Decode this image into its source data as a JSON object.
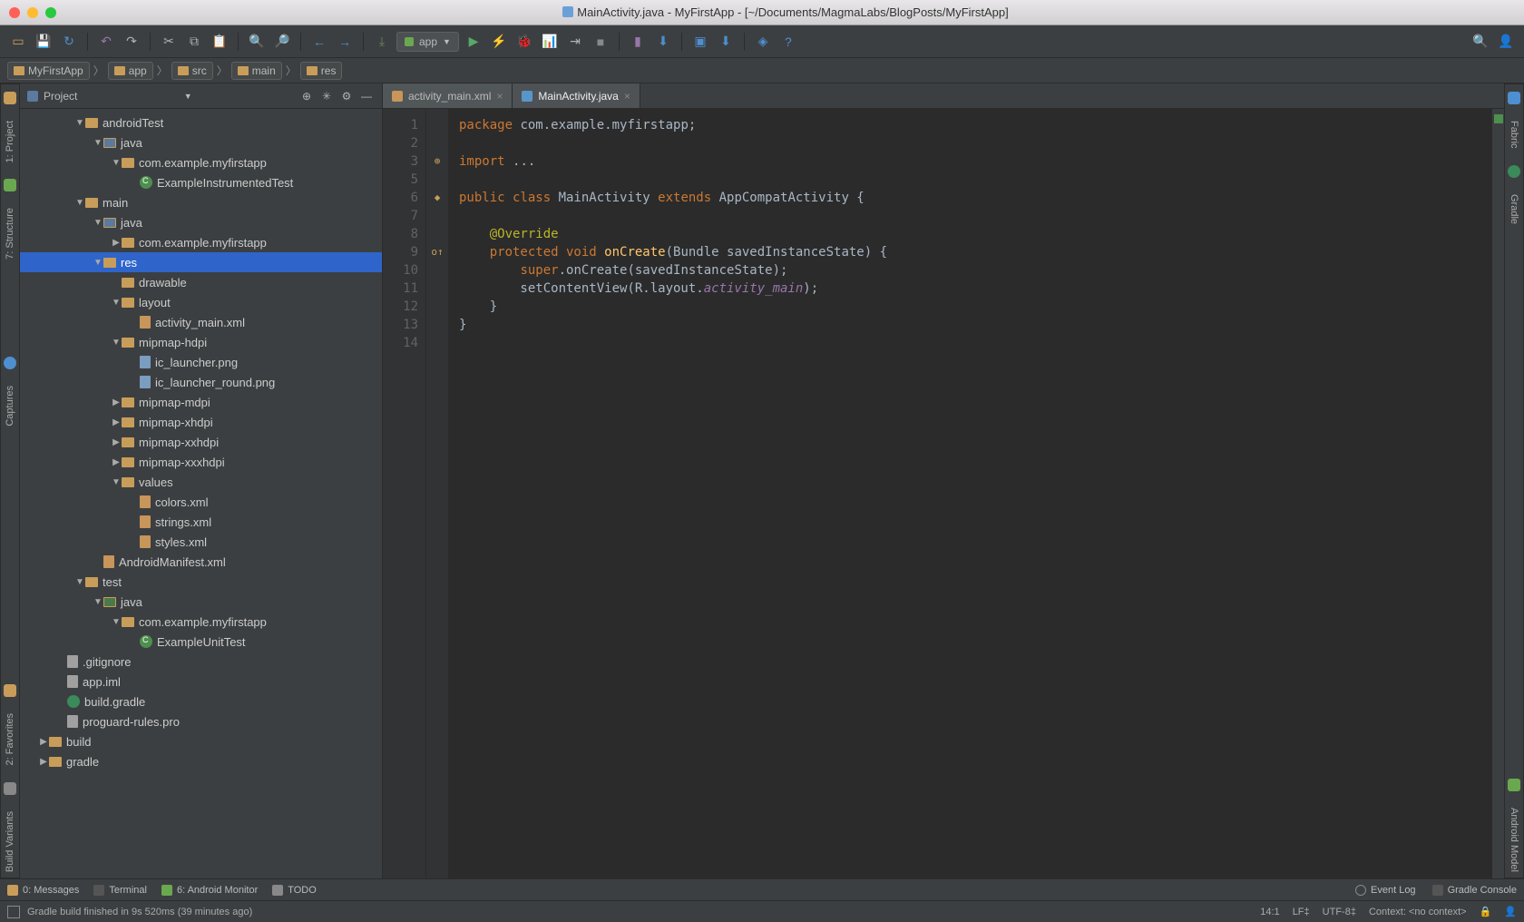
{
  "window": {
    "title": "MainActivity.java - MyFirstApp - [~/Documents/MagmaLabs/BlogPosts/MyFirstApp]"
  },
  "runConfig": "app",
  "breadcrumbs": [
    "MyFirstApp",
    "app",
    "src",
    "main",
    "res"
  ],
  "sidebar": {
    "title": "Project",
    "tree": [
      {
        "indent": 2,
        "arrow": "▼",
        "icon": "folder",
        "label": "androidTest"
      },
      {
        "indent": 3,
        "arrow": "▼",
        "icon": "folder-blue",
        "label": "java"
      },
      {
        "indent": 4,
        "arrow": "▼",
        "icon": "folder",
        "label": "com.example.myfirstapp"
      },
      {
        "indent": 5,
        "arrow": "",
        "icon": "class",
        "label": "ExampleInstrumentedTest"
      },
      {
        "indent": 2,
        "arrow": "▼",
        "icon": "folder",
        "label": "main"
      },
      {
        "indent": 3,
        "arrow": "▼",
        "icon": "folder-blue",
        "label": "java"
      },
      {
        "indent": 4,
        "arrow": "▶",
        "icon": "folder",
        "label": "com.example.myfirstapp"
      },
      {
        "indent": 3,
        "arrow": "▼",
        "icon": "folder",
        "label": "res",
        "selected": true
      },
      {
        "indent": 4,
        "arrow": "",
        "icon": "folder",
        "label": "drawable"
      },
      {
        "indent": 4,
        "arrow": "▼",
        "icon": "folder",
        "label": "layout"
      },
      {
        "indent": 5,
        "arrow": "",
        "icon": "file-xml",
        "label": "activity_main.xml"
      },
      {
        "indent": 4,
        "arrow": "▼",
        "icon": "folder",
        "label": "mipmap-hdpi"
      },
      {
        "indent": 5,
        "arrow": "",
        "icon": "file-img",
        "label": "ic_launcher.png"
      },
      {
        "indent": 5,
        "arrow": "",
        "icon": "file-img",
        "label": "ic_launcher_round.png"
      },
      {
        "indent": 4,
        "arrow": "▶",
        "icon": "folder",
        "label": "mipmap-mdpi"
      },
      {
        "indent": 4,
        "arrow": "▶",
        "icon": "folder",
        "label": "mipmap-xhdpi"
      },
      {
        "indent": 4,
        "arrow": "▶",
        "icon": "folder",
        "label": "mipmap-xxhdpi"
      },
      {
        "indent": 4,
        "arrow": "▶",
        "icon": "folder",
        "label": "mipmap-xxxhdpi"
      },
      {
        "indent": 4,
        "arrow": "▼",
        "icon": "folder",
        "label": "values"
      },
      {
        "indent": 5,
        "arrow": "",
        "icon": "file-xml",
        "label": "colors.xml"
      },
      {
        "indent": 5,
        "arrow": "",
        "icon": "file-xml",
        "label": "strings.xml"
      },
      {
        "indent": 5,
        "arrow": "",
        "icon": "file-xml",
        "label": "styles.xml"
      },
      {
        "indent": 3,
        "arrow": "",
        "icon": "file-xml",
        "label": "AndroidManifest.xml"
      },
      {
        "indent": 2,
        "arrow": "▼",
        "icon": "folder",
        "label": "test"
      },
      {
        "indent": 3,
        "arrow": "▼",
        "icon": "folder-green",
        "label": "java"
      },
      {
        "indent": 4,
        "arrow": "▼",
        "icon": "folder",
        "label": "com.example.myfirstapp"
      },
      {
        "indent": 5,
        "arrow": "",
        "icon": "class",
        "label": "ExampleUnitTest"
      },
      {
        "indent": 1,
        "arrow": "",
        "icon": "file",
        "label": ".gitignore"
      },
      {
        "indent": 1,
        "arrow": "",
        "icon": "file",
        "label": "app.iml"
      },
      {
        "indent": 1,
        "arrow": "",
        "icon": "gradle",
        "label": "build.gradle"
      },
      {
        "indent": 1,
        "arrow": "",
        "icon": "file",
        "label": "proguard-rules.pro"
      },
      {
        "indent": 0,
        "arrow": "▶",
        "icon": "folder",
        "label": "build"
      },
      {
        "indent": 0,
        "arrow": "▶",
        "icon": "folder",
        "label": "gradle"
      }
    ]
  },
  "tabs": [
    {
      "label": "activity_main.xml",
      "iconColor": "#c8955a",
      "active": false
    },
    {
      "label": "MainActivity.java",
      "iconColor": "#5896c9",
      "active": true
    }
  ],
  "editor": {
    "lines": [
      {
        "n": 1,
        "tokens": [
          [
            "kw",
            "package "
          ],
          [
            "cls",
            "com.example.myfirstapp"
          ],
          [
            "cls",
            ";"
          ]
        ]
      },
      {
        "n": 2,
        "tokens": []
      },
      {
        "n": 3,
        "gutter": "⊕",
        "tokens": [
          [
            "kw",
            "import "
          ],
          [
            "cls",
            "..."
          ]
        ]
      },
      {
        "n": 5,
        "tokens": []
      },
      {
        "n": 6,
        "gutter": "◆",
        "tokens": [
          [
            "kw",
            "public class "
          ],
          [
            "cls",
            "MainActivity "
          ],
          [
            "kw",
            "extends "
          ],
          [
            "cls",
            "AppCompatActivity {"
          ]
        ]
      },
      {
        "n": 7,
        "tokens": []
      },
      {
        "n": 8,
        "tokens": [
          [
            "cls",
            "    "
          ],
          [
            "ann",
            "@Override"
          ]
        ]
      },
      {
        "n": 9,
        "gutter": "o↑",
        "tokens": [
          [
            "cls",
            "    "
          ],
          [
            "kw",
            "protected void "
          ],
          [
            "fn",
            "onCreate"
          ],
          [
            "cls",
            "(Bundle savedInstanceState) {"
          ]
        ]
      },
      {
        "n": 10,
        "tokens": [
          [
            "cls",
            "        "
          ],
          [
            "kw",
            "super"
          ],
          [
            "cls",
            ".onCreate(savedInstanceState);"
          ]
        ]
      },
      {
        "n": 11,
        "tokens": [
          [
            "cls",
            "        setContentView(R.layout."
          ],
          [
            "fld",
            "activity_main"
          ],
          [
            "cls",
            ");"
          ]
        ]
      },
      {
        "n": 12,
        "tokens": [
          [
            "cls",
            "    }"
          ]
        ]
      },
      {
        "n": 13,
        "tokens": [
          [
            "cls",
            "}"
          ]
        ]
      },
      {
        "n": 14,
        "caret": true,
        "tokens": []
      }
    ]
  },
  "leftBar": [
    "1: Project",
    "7: Structure",
    "Captures"
  ],
  "rightBar": [
    "Fabric",
    "Gradle",
    "Android Model"
  ],
  "bottomTabs": {
    "left": [
      "0: Messages",
      "Terminal",
      "6: Android Monitor",
      "TODO"
    ],
    "right": [
      "Event Log",
      "Gradle Console"
    ]
  },
  "status": {
    "message": "Gradle build finished in 9s 520ms (39 minutes ago)",
    "pos": "14:1",
    "lf": "LF",
    "enc": "UTF-8",
    "context": "Context: <no context>"
  }
}
